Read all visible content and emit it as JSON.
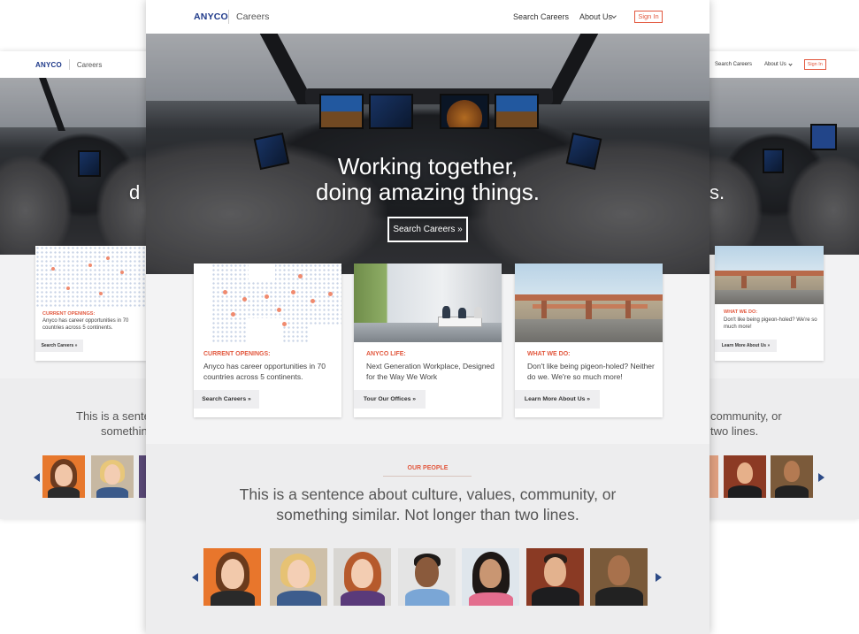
{
  "brand": {
    "logo": "ANYCO",
    "section": "Careers"
  },
  "nav": {
    "search_careers": "Search Careers",
    "about_us": "About Us",
    "sign_in": "Sign In"
  },
  "hero": {
    "title_line1": "Working together,",
    "title_line2": "doing amazing things.",
    "button": "Search Careers »"
  },
  "cards": [
    {
      "tag": "CURRENT OPENINGS:",
      "description": "Anyco has career opportunities in 70 countries across 5 continents.",
      "button": "Search Careers »"
    },
    {
      "tag": "ANYCO LIFE:",
      "description": "Next Generation Workplace, Designed for the Way We Work",
      "button": "Tour Our Offices »"
    },
    {
      "tag": "WHAT WE DO:",
      "description": "Don't like being pigeon-holed? Neither do we.  We're so much more!",
      "button": "Learn More About Us »"
    }
  ],
  "people": {
    "eyebrow": "OUR PEOPLE",
    "statement_line1": "This is a sentence about culture, values, community, or",
    "statement_line2": "something similar. Not longer than two lines."
  },
  "left_panel": {
    "tag": "CURRENT OPENINGS:",
    "description": "Anyco has career opportunities in 70 countries across 5 continents.",
    "button": "Search Careers »",
    "statement_fragment1": "This is a sentenc",
    "statement_fragment2": "somethin",
    "hero_fragment": "d"
  },
  "right_panel": {
    "tag": "WHAT WE DO:",
    "description": "Don't like being pigeon-holed? We're so much more!",
    "button": "Learn More About Us »",
    "statement_fragment1": "community, or",
    "statement_fragment2": "two lines.",
    "hero_fragment": "s."
  },
  "colors": {
    "brand_blue": "#1f3a8a",
    "accent": "#e2583e",
    "band": "#ededee"
  },
  "icons": {
    "prev": "chevron-left-icon",
    "next": "chevron-right-icon",
    "about_dropdown": "chevron-down-icon"
  }
}
